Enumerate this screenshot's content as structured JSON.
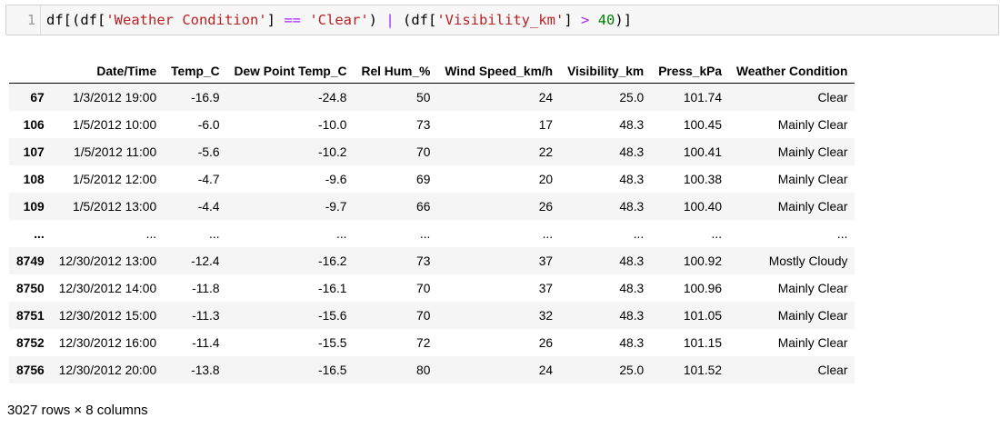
{
  "code_cell": {
    "line_number": "1",
    "tokens": [
      {
        "text": "df[(df[",
        "style": "plain"
      },
      {
        "text": "'Weather Condition'",
        "style": "str"
      },
      {
        "text": "] ",
        "style": "plain"
      },
      {
        "text": "==",
        "style": "op"
      },
      {
        "text": " ",
        "style": "plain"
      },
      {
        "text": "'Clear'",
        "style": "str"
      },
      {
        "text": ") ",
        "style": "plain"
      },
      {
        "text": "|",
        "style": "op"
      },
      {
        "text": " (df[",
        "style": "plain"
      },
      {
        "text": "'Visibility_km'",
        "style": "str"
      },
      {
        "text": "] ",
        "style": "plain"
      },
      {
        "text": ">",
        "style": "op"
      },
      {
        "text": " ",
        "style": "plain"
      },
      {
        "text": "40",
        "style": "num"
      },
      {
        "text": ")]",
        "style": "plain"
      }
    ]
  },
  "table": {
    "columns": [
      "",
      "Date/Time",
      "Temp_C",
      "Dew Point Temp_C",
      "Rel Hum_%",
      "Wind Speed_km/h",
      "Visibility_km",
      "Press_kPa",
      "Weather Condition"
    ],
    "rows": [
      {
        "index": "67",
        "cells": [
          "1/3/2012 19:00",
          "-16.9",
          "-24.8",
          "50",
          "24",
          "25.0",
          "101.74",
          "Clear"
        ]
      },
      {
        "index": "106",
        "cells": [
          "1/5/2012 10:00",
          "-6.0",
          "-10.0",
          "73",
          "17",
          "48.3",
          "100.45",
          "Mainly Clear"
        ]
      },
      {
        "index": "107",
        "cells": [
          "1/5/2012 11:00",
          "-5.6",
          "-10.2",
          "70",
          "22",
          "48.3",
          "100.41",
          "Mainly Clear"
        ]
      },
      {
        "index": "108",
        "cells": [
          "1/5/2012 12:00",
          "-4.7",
          "-9.6",
          "69",
          "20",
          "48.3",
          "100.38",
          "Mainly Clear"
        ]
      },
      {
        "index": "109",
        "cells": [
          "1/5/2012 13:00",
          "-4.4",
          "-9.7",
          "66",
          "26",
          "48.3",
          "100.40",
          "Mainly Clear"
        ]
      },
      {
        "index": "...",
        "cells": [
          "...",
          "...",
          "...",
          "...",
          "...",
          "...",
          "...",
          "..."
        ]
      },
      {
        "index": "8749",
        "cells": [
          "12/30/2012 13:00",
          "-12.4",
          "-16.2",
          "73",
          "37",
          "48.3",
          "100.92",
          "Mostly Cloudy"
        ]
      },
      {
        "index": "8750",
        "cells": [
          "12/30/2012 14:00",
          "-11.8",
          "-16.1",
          "70",
          "37",
          "48.3",
          "100.96",
          "Mainly Clear"
        ]
      },
      {
        "index": "8751",
        "cells": [
          "12/30/2012 15:00",
          "-11.3",
          "-15.6",
          "70",
          "32",
          "48.3",
          "101.05",
          "Mainly Clear"
        ]
      },
      {
        "index": "8752",
        "cells": [
          "12/30/2012 16:00",
          "-11.4",
          "-15.5",
          "72",
          "26",
          "48.3",
          "101.15",
          "Mainly Clear"
        ]
      },
      {
        "index": "8756",
        "cells": [
          "12/30/2012 20:00",
          "-13.8",
          "-16.5",
          "80",
          "24",
          "25.0",
          "101.52",
          "Clear"
        ]
      }
    ]
  },
  "footer": "3027 rows × 8 columns",
  "colors": {
    "string": "#ba2121",
    "operator": "#aa22ff",
    "number": "#008000",
    "stripe": "#f5f5f5"
  }
}
